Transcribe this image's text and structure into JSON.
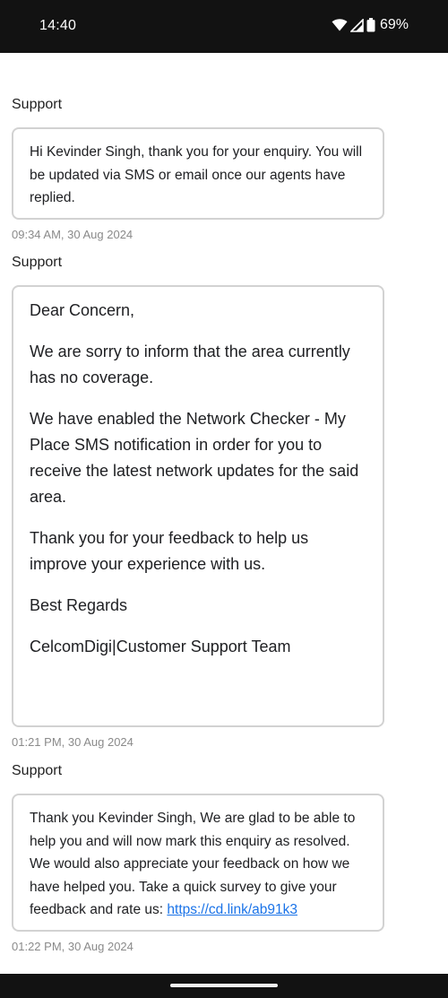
{
  "status_bar": {
    "time": "14:40",
    "battery": "69%",
    "icons": [
      "wifi-icon",
      "signal-icon",
      "battery-icon"
    ]
  },
  "messages": [
    {
      "sender": "Support",
      "paragraphs": [
        "Hi Kevinder Singh, thank you for your enquiry. You will be updated via SMS or email once our agents have replied."
      ],
      "timestamp": "09:34 AM, 30 Aug 2024"
    },
    {
      "sender": "Support",
      "paragraphs": [
        "Dear Concern,",
        "We are sorry to inform that the area currently has no coverage.",
        "We have enabled the Network Checker - My Place SMS notification in order for you to receive the latest network updates for the said area.",
        "Thank you for your feedback to help us improve your experience with us.",
        "Best Regards",
        "CelcomDigi|Customer Support Team"
      ],
      "timestamp": "01:21 PM, 30 Aug 2024"
    },
    {
      "sender": "Support",
      "text_before_link": "Thank you Kevinder Singh, We are glad to be able to help you and will now mark this enquiry as resolved. We would also appreciate your feedback on how we have helped you. Take a quick survey to give your feedback and rate us: ",
      "link": "https://cd.link/ab91k3",
      "timestamp": "01:22 PM, 30 Aug 2024"
    }
  ],
  "colors": {
    "status_bar_bg": "#121212",
    "bubble_border": "#d2d2d2",
    "timestamp": "#8a8a8a",
    "link": "#1a73e8"
  }
}
